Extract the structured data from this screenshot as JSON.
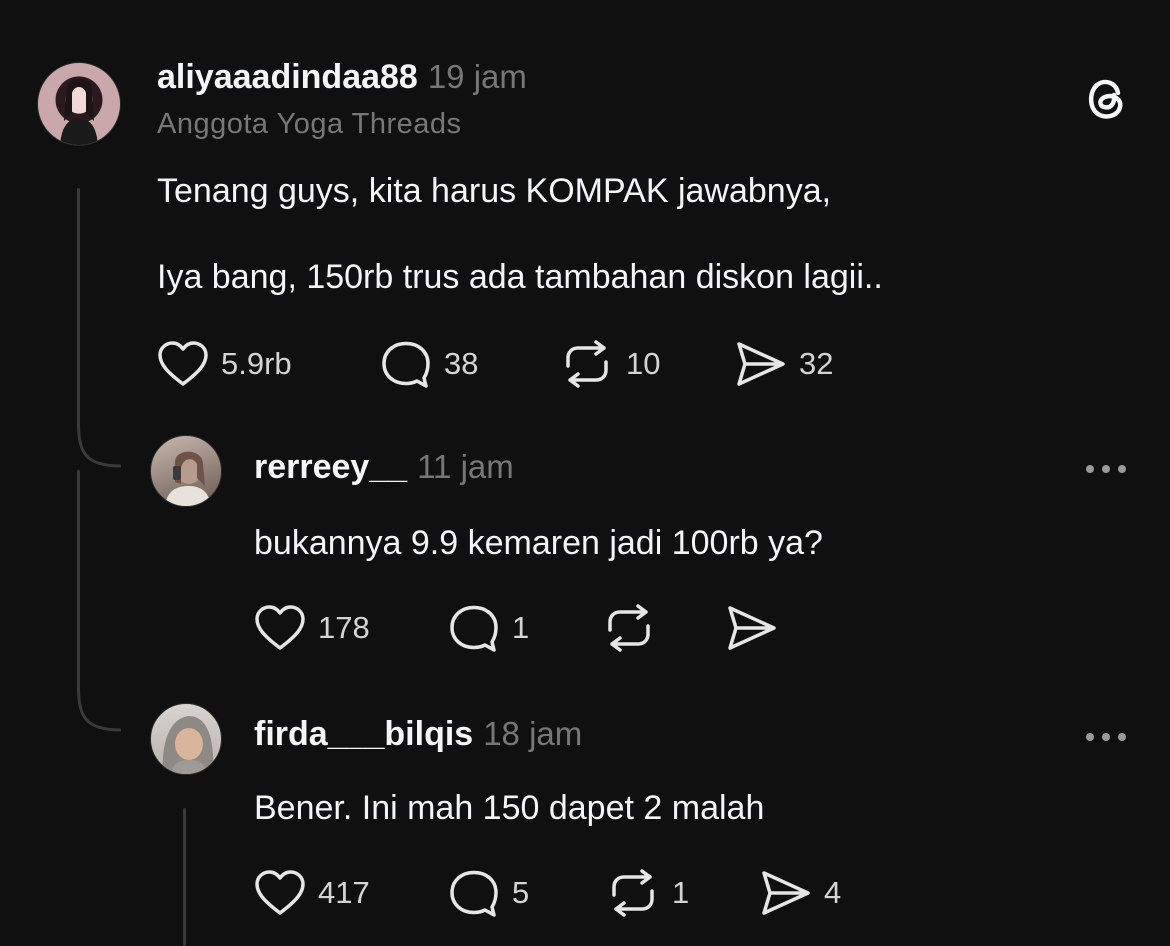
{
  "post": {
    "username": "aliyaaadindaa88",
    "time": "19 jam",
    "subtitle": "Anggota Yoga Threads",
    "lines": [
      "Tenang guys, kita harus KOMPAK jawabnya,",
      "Iya bang, 150rb trus ada tambahan diskon lagii.."
    ],
    "likes": "5.9rb",
    "comments": "38",
    "reposts": "10",
    "shares": "32"
  },
  "replies": [
    {
      "username": "rerreey__",
      "time": "11 jam",
      "text": "bukannya 9.9 kemaren jadi 100rb ya?",
      "likes": "178",
      "comments": "1",
      "reposts": "",
      "shares": ""
    },
    {
      "username": "firda___bilqis",
      "time": "18 jam",
      "text": "Bener. Ini mah 150 dapet 2 malah",
      "likes": "417",
      "comments": "5",
      "reposts": "1",
      "shares": "4"
    }
  ],
  "icons": {
    "app_logo": "threads-logo-icon",
    "like": "heart-icon",
    "comment": "comment-bubble-icon",
    "repost": "repost-icon",
    "share": "send-icon",
    "more": "more-options-icon"
  }
}
